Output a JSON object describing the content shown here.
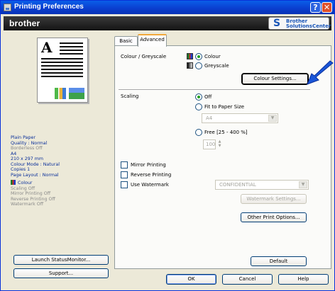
{
  "window": {
    "title": "Printing Preferences",
    "help_glyph": "?",
    "close_glyph": "✕"
  },
  "banner": {
    "logo": "brother",
    "solutions_line1": "Brother",
    "solutions_line2": "SolutionsCenter"
  },
  "preview": {
    "letter": "A"
  },
  "summary": {
    "lines": [
      "Plain Paper",
      "Quality : Normal",
      "Borderless Off",
      "A4",
      "210 x 297 mm",
      "Colour Mode : Natural",
      "Copies 1",
      "Page Layout : Normal"
    ],
    "colour_label": "Colour",
    "gray_lines": [
      "Scaling Off",
      "Mirror Printing Off",
      "Reverse Printing Off",
      "Watermark Off"
    ]
  },
  "left_buttons": {
    "launch": "Launch StatusMonitor...",
    "support": "Support..."
  },
  "tabs": [
    {
      "label": "Basic"
    },
    {
      "label": "Advanced"
    }
  ],
  "colour_greyscale": {
    "label": "Colour / Greyscale",
    "options": [
      {
        "label": "Colour",
        "selected": true
      },
      {
        "label": "Greyscale",
        "selected": false
      }
    ],
    "settings_button": "Colour Settings..."
  },
  "scaling": {
    "label": "Scaling",
    "options": [
      {
        "label": "Off",
        "selected": true
      },
      {
        "label": "Fit to Paper Size",
        "selected": false
      },
      {
        "label": "Free [25 - 400 %]",
        "selected": false
      }
    ],
    "paper_size_value": "A4",
    "free_value": "100"
  },
  "checkboxes": {
    "mirror": {
      "label": "Mirror Printing",
      "checked": false
    },
    "reverse": {
      "label": "Reverse Printing",
      "checked": false
    },
    "watermark": {
      "label": "Use Watermark",
      "checked": false
    }
  },
  "watermark": {
    "selected": "CONFIDENTIAL",
    "settings_button": "Watermark Settings..."
  },
  "other_button": "Other Print Options...",
  "default_button": "Default",
  "bottom_buttons": {
    "ok": "OK",
    "cancel": "Cancel",
    "help": "Help"
  },
  "colors": {
    "title_bar": "#0a4fd8",
    "banner": "#1e1e1e",
    "accent_blue": "#0a2f9a",
    "pointer_arrow": "#1a56d8"
  },
  "icons": {
    "pointer": "arrow-pointer-icon",
    "solutions": "swoosh-icon"
  }
}
